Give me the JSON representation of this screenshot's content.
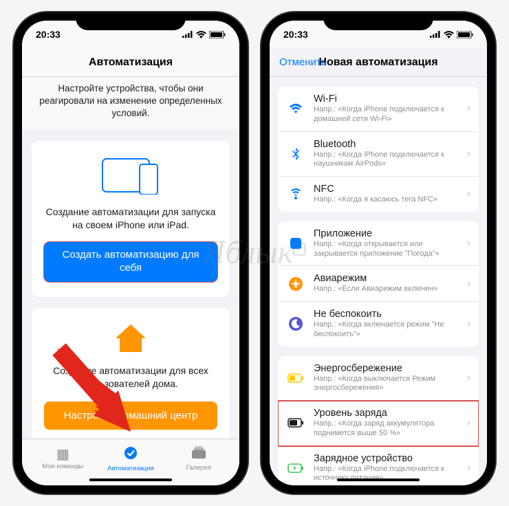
{
  "status": {
    "time": "20:33"
  },
  "left": {
    "header_title": "Автоматизация",
    "subtitle": "Настройте устройства, чтобы они реагировали на изменение определенных условий.",
    "card_personal": {
      "text": "Создание автоматизации для запуска на своем iPhone или iPad.",
      "button": "Создать автоматизацию для себя"
    },
    "card_home": {
      "text": "Создание автоматизации для всех пользователей дома.",
      "button": "Настроить домашний центр"
    },
    "tabs": {
      "shortcuts": "Мои команды",
      "automation": "Автоматизация",
      "gallery": "Галерея"
    }
  },
  "right": {
    "cancel": "Отменить",
    "header_title": "Новая автоматизация",
    "groups": [
      [
        {
          "icon": "wifi",
          "title": "Wi-Fi",
          "sub": "Напр.: «Когда iPhone подключается к домашней сети Wi-Fi»"
        },
        {
          "icon": "bluetooth",
          "title": "Bluetooth",
          "sub": "Напр.: «Когда iPhone подключается к наушникам AirPods»"
        },
        {
          "icon": "nfc",
          "title": "NFC",
          "sub": "Напр.: «Когда я касаюсь тега NFC»"
        }
      ],
      [
        {
          "icon": "app",
          "title": "Приложение",
          "sub": "Напр.: «Когда открывается или закрывается приложение \"Погода\"»"
        },
        {
          "icon": "airplane",
          "title": "Авиарежим",
          "sub": "Напр.: «Если Авиарежим включен»"
        },
        {
          "icon": "dnd",
          "title": "Не беспокоить",
          "sub": "Напр.: «Когда включается режим \"Не беспокоить\"»"
        }
      ],
      [
        {
          "icon": "lowpower",
          "title": "Энергосбережение",
          "sub": "Напр.: «Когда выключается Режим энергосбережения»"
        },
        {
          "icon": "battery",
          "title": "Уровень заряда",
          "sub": "Напр.: «Когда заряд аккумулятора поднимется выше 50 %»",
          "highlight": true
        },
        {
          "icon": "charger",
          "title": "Зарядное устройство",
          "sub": "Напр.: «Когда iPhone подключается к источнику питания»"
        }
      ]
    ]
  },
  "watermark": "Яблык"
}
